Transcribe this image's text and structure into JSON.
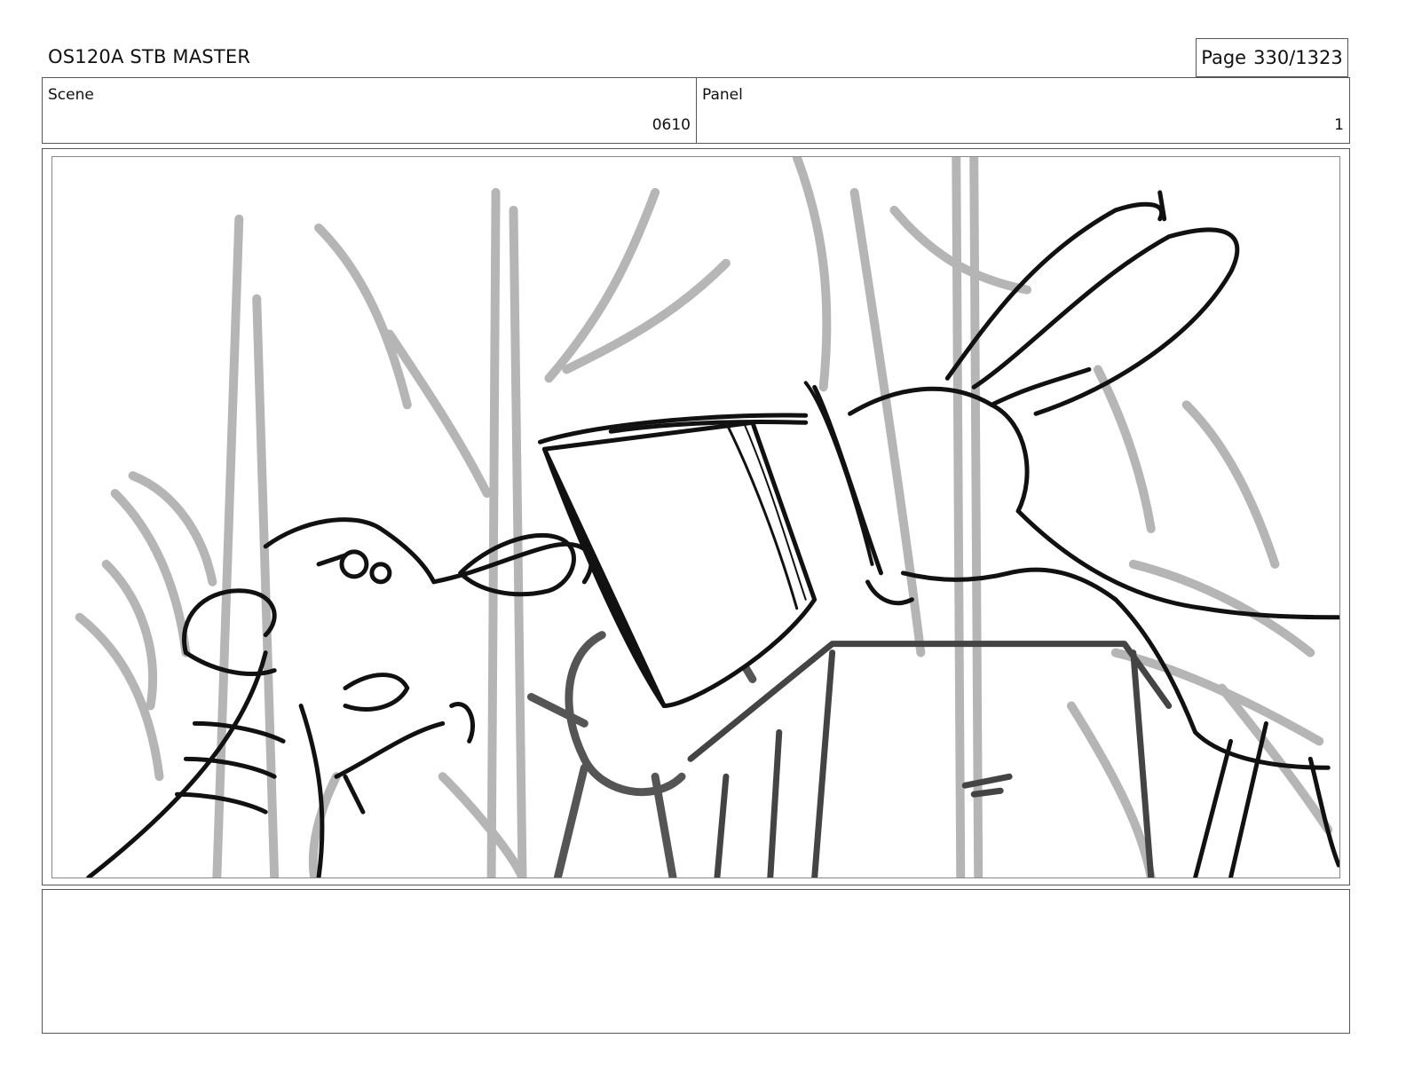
{
  "header": {
    "title": "OS120A STB MASTER",
    "page_label": "Page",
    "page_number": "330/1323"
  },
  "info": {
    "scene_label": "Scene",
    "scene_value": "0610",
    "panel_label": "Panel",
    "panel_value": "1"
  },
  "artwork": {
    "description_icon": "storyboard-sketch"
  },
  "notes": {
    "text": ""
  }
}
